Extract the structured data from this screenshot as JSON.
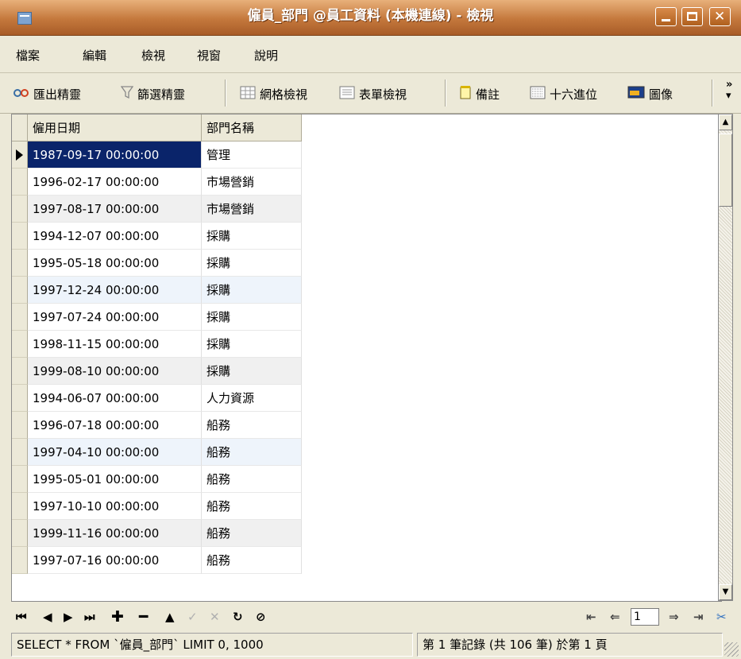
{
  "window": {
    "title": "僱員_部門 @員工資料 (本機連線) - 檢視"
  },
  "menu": [
    "檔案",
    "編輯",
    "檢視",
    "視窗",
    "說明"
  ],
  "toolbar": {
    "export_wizard": "匯出精靈",
    "filter_wizard": "篩選精靈",
    "grid_view": "網格檢視",
    "form_view": "表單檢視",
    "memo": "備註",
    "hex": "十六進位",
    "image": "圖像",
    "more": "»"
  },
  "grid": {
    "columns": [
      "僱用日期",
      "部門名稱"
    ],
    "rows": [
      [
        "1987-09-17 00:00:00",
        "管理"
      ],
      [
        "1996-02-17 00:00:00",
        "市場營銷"
      ],
      [
        "1997-08-17 00:00:00",
        "市場營銷"
      ],
      [
        "1994-12-07 00:00:00",
        "採購"
      ],
      [
        "1995-05-18 00:00:00",
        "採購"
      ],
      [
        "1997-12-24 00:00:00",
        "採購"
      ],
      [
        "1997-07-24 00:00:00",
        "採購"
      ],
      [
        "1998-11-15 00:00:00",
        "採購"
      ],
      [
        "1999-08-10 00:00:00",
        "採購"
      ],
      [
        "1994-06-07 00:00:00",
        "人力資源"
      ],
      [
        "1996-07-18 00:00:00",
        "船務"
      ],
      [
        "1997-04-10 00:00:00",
        "船務"
      ],
      [
        "1995-05-01 00:00:00",
        "船務"
      ],
      [
        "1997-10-10 00:00:00",
        "船務"
      ],
      [
        "1999-11-16 00:00:00",
        "船務"
      ],
      [
        "1997-07-16 00:00:00",
        "船務"
      ]
    ],
    "selected_row": 0
  },
  "nav": {
    "page": "1"
  },
  "status": {
    "sql": "SELECT * FROM `僱員_部門` LIMIT 0, 1000",
    "records": "第 1 筆記錄 (共 106 筆) 於第 1 頁"
  },
  "colors": {
    "titlebar": "#c4783c",
    "selection": "#0a246a",
    "face": "#ece9d8"
  }
}
